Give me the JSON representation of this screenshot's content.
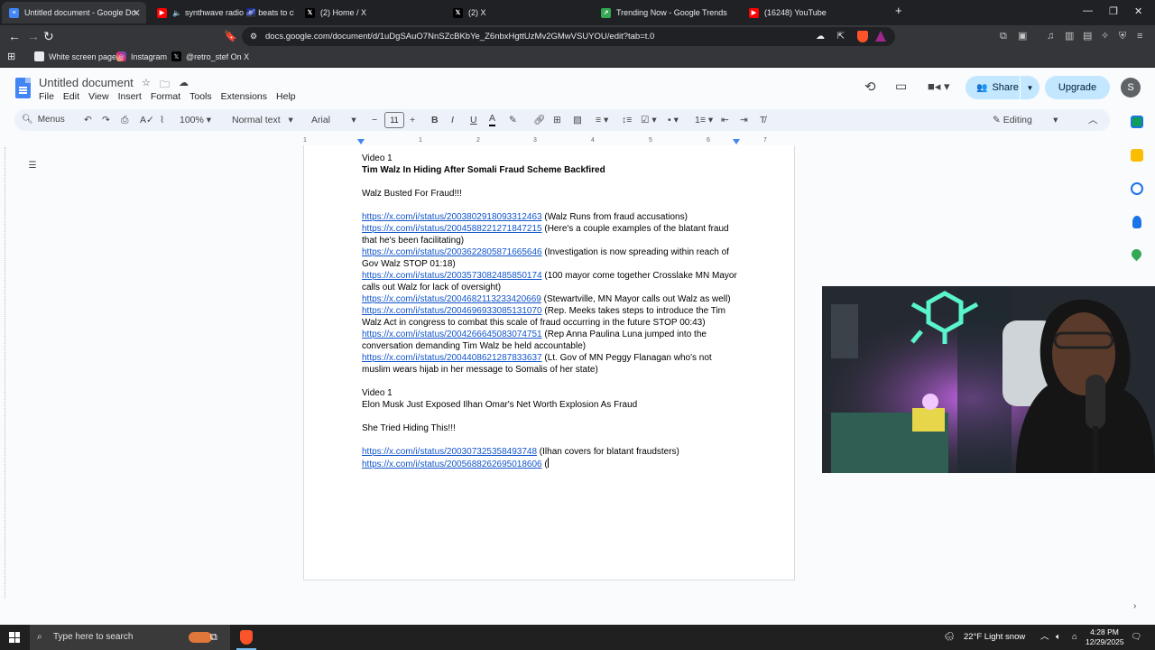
{
  "browser": {
    "tabs": [
      {
        "title": "Untitled document - Google Docs",
        "active": true,
        "icon": "docs-icon"
      },
      {
        "title": "synthwave radio 🌌 beats to chill",
        "active": false,
        "icon": "youtube-icon"
      },
      {
        "title": "(2) Home / X",
        "active": false,
        "icon": "x-icon"
      },
      {
        "title": "(2) X",
        "active": false,
        "icon": "x-icon"
      },
      {
        "title": "Trending Now - Google Trends",
        "active": false,
        "icon": "trends-icon"
      },
      {
        "title": "(16248) YouTube",
        "active": false,
        "icon": "youtube-icon"
      }
    ],
    "url": "docs.google.com/document/d/1uDgSAuO7NnSZcBKbYe_Z6nbxHgttUzMv2GMwVSUYOU/edit?tab=t.0",
    "bookmarks": [
      {
        "label": "White screen page",
        "icon": "page-icon"
      },
      {
        "label": "Instagram",
        "icon": "instagram-icon"
      },
      {
        "label": "@retro_stef On X",
        "icon": "x-icon"
      }
    ]
  },
  "docs": {
    "title": "Untitled document",
    "menu": [
      "File",
      "Edit",
      "View",
      "Insert",
      "Format",
      "Tools",
      "Extensions",
      "Help"
    ],
    "share_label": "Share",
    "upgrade_label": "Upgrade",
    "avatar_letter": "S",
    "toolbar": {
      "search_label": "Menus",
      "zoom": "100%",
      "style": "Normal text",
      "font": "Arial",
      "font_size": "11",
      "mode": "Editing"
    },
    "ruler_ticks": [
      "1",
      "1",
      "2",
      "3",
      "4",
      "5",
      "6",
      "7"
    ],
    "content": [
      {
        "text": "Video 1",
        "bold": false
      },
      {
        "text": "Tim Walz In Hiding After Somali Fraud Scheme Backfired",
        "bold": true
      },
      {
        "text": "",
        "bold": false
      },
      {
        "text": "Walz Busted For Fraud!!!",
        "bold": false
      },
      {
        "text": "",
        "bold": false
      },
      {
        "link": "https://x.com/i/status/2003802918093312463",
        "text": " (Walz Runs from fraud accusations)"
      },
      {
        "link": "https://x.com/i/status/2004588221271847215",
        "text": " (Here's a couple examples of the blatant fraud that he's been facilitating)"
      },
      {
        "link": "https://x.com/i/status/2003622805871665646",
        "text": " (Investigation is now spreading within reach of Gov Walz STOP 01:18)"
      },
      {
        "link": "https://x.com/i/status/2003573082485850174",
        "text": " (100 mayor come together Crosslake MN Mayor calls out Walz for lack of oversight)"
      },
      {
        "link": "https://x.com/i/status/2004682113233420669",
        "text": " (Stewartville, MN Mayor calls out Walz as well)"
      },
      {
        "link": "https://x.com/i/status/2004696933085131070",
        "text": " (Rep. Meeks takes steps to introduce the Tim Walz Act in congress to combat this scale of fraud occurring in the future STOP 00:43)"
      },
      {
        "link": "https://x.com/i/status/2004266645083074751",
        "text": " (Rep Anna Paulina Luna jumped into the conversation demanding Tim Walz be held accountable)"
      },
      {
        "link": "https://x.com/i/status/2004408621287833637",
        "text": " (Lt. Gov of MN Peggy Flanagan who's not muslim wears hijab in her message to Somalis of her state)"
      },
      {
        "text": "",
        "bold": false
      },
      {
        "text": "Video 1",
        "bold": false
      },
      {
        "text": "Elon Musk Just Exposed Ilhan Omar's Net Worth Explosion As Fraud",
        "bold": false
      },
      {
        "text": "",
        "bold": false
      },
      {
        "text": "She Tried Hiding This!!!",
        "bold": false
      },
      {
        "text": "",
        "bold": false
      },
      {
        "link": "https://x.com/i/status/2003073253584937​48",
        "text": " (Ilhan covers for blatant fraudsters)"
      },
      {
        "link": "https://x.com/i/status/2005688262695018606",
        "text": " ("
      }
    ]
  },
  "taskbar": {
    "search_placeholder": "Type here to search",
    "weather": "22°F  Light snow",
    "time": "4:28 PM",
    "date": "12/29/2025"
  },
  "colors": {
    "accent": "#c2e7ff",
    "link": "#1155cc",
    "chrome_dark": "#202124"
  }
}
